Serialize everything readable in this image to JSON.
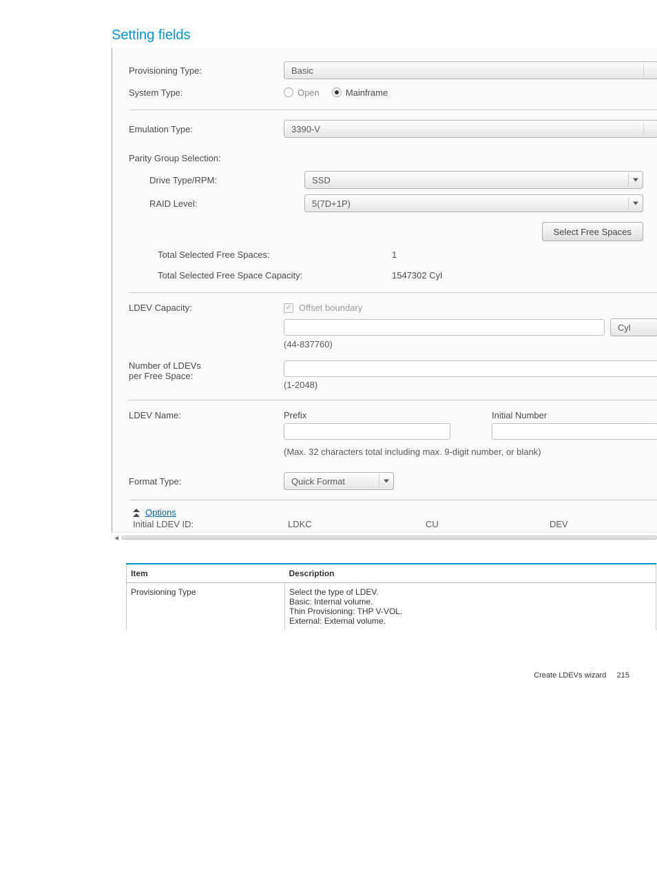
{
  "heading": "Setting fields",
  "form": {
    "provisioningType": {
      "label": "Provisioning Type:",
      "value": "Basic"
    },
    "systemType": {
      "label": "System Type:",
      "options": [
        {
          "label": "Open",
          "selected": false
        },
        {
          "label": "Mainframe",
          "selected": true
        }
      ]
    },
    "emulationType": {
      "label": "Emulation Type:",
      "value": "3390-V"
    },
    "parityGroup": {
      "label": "Parity Group Selection:"
    },
    "driveType": {
      "label": "Drive Type/RPM:",
      "value": "SSD"
    },
    "raidLevel": {
      "label": "RAID Level:",
      "value": "5(7D+1P)"
    },
    "selectFreeSpaces": "Select Free Spaces",
    "totalSelectedFreeSpaces": {
      "label": "Total Selected Free Spaces:",
      "value": "1"
    },
    "totalSelectedFreeSpaceCapacity": {
      "label": "Total Selected Free Space Capacity:",
      "value": "1547302 Cyl"
    },
    "ldevCapacity": {
      "label": "LDEV Capacity:",
      "offsetBoundary": "Offset boundary",
      "unit": "Cyl",
      "range": "(44-837760)"
    },
    "numLdevs": {
      "label1": "Number of LDEVs",
      "label2": "per Free Space:",
      "range": "(1-2048)"
    },
    "ldevName": {
      "label": "LDEV Name:",
      "prefix": "Prefix",
      "initialNumber": "Initial Number",
      "hint": "(Max. 32 characters total including max. 9-digit number, or blank)"
    },
    "formatType": {
      "label": "Format Type:",
      "value": "Quick Format"
    },
    "options": "Options",
    "initialLdevId": {
      "label": "Initial LDEV ID:",
      "c1": "LDKC",
      "c2": "CU",
      "c3": "DEV"
    }
  },
  "table": {
    "headers": {
      "item": "Item",
      "description": "Description"
    },
    "row": {
      "item": "Provisioning Type",
      "lines": [
        "Select the type of LDEV.",
        "Basic: Internal volume.",
        "Thin Provisioning: THP V-VOL.",
        "External: External volume."
      ]
    }
  },
  "footer": {
    "text": "Create LDEVs wizard",
    "page": "215"
  }
}
